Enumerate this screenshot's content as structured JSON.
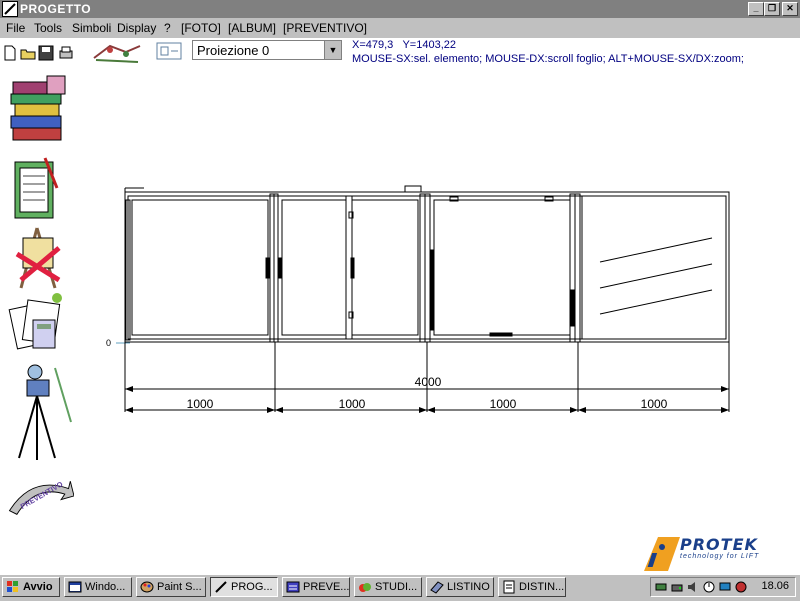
{
  "window": {
    "title": "PROGETTO",
    "controls": {
      "minimize": "_",
      "restore": "❐",
      "close": "✕"
    }
  },
  "menu": {
    "items": [
      "File",
      "Tools",
      "Simboli",
      "Display",
      "?",
      "[FOTO]",
      "[ALBUM]",
      "[PREVENTIVO]"
    ]
  },
  "toolbar": {
    "projection_value": "Proiezione 0",
    "coords_x": "X=479,3",
    "coords_y": "Y=1403,22",
    "hint": "MOUSE-SX:sel. elemento; MOUSE-DX:scroll foglio; ALT+MOUSE-SX/DX:zoom;"
  },
  "sidebar": {
    "icons": [
      "books-icon",
      "clipboard-icon",
      "easel-icon",
      "documents-calculator-icon",
      "camera-tripod-icon",
      "preventivo-arrow-icon"
    ],
    "arrow_label": "PREVENTIVO"
  },
  "drawing": {
    "origin_label": "0",
    "total_dimension": "4000",
    "segment_dimensions": [
      "1000",
      "1000",
      "1000",
      "1000"
    ]
  },
  "logo": {
    "brand": "PROTEK",
    "tagline": "technology for LIFT"
  },
  "taskbar": {
    "start_label": "Avvio",
    "buttons": [
      "Windo...",
      "Paint S...",
      "PROG...",
      "PREVE...",
      "STUDI...",
      "LISTINO",
      "DISTIN..."
    ],
    "clock": "18.06"
  }
}
